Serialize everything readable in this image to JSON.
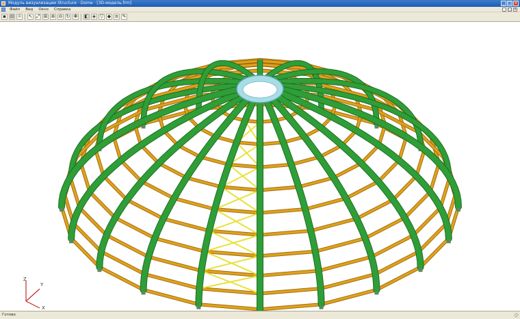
{
  "window": {
    "title": "Модуль визуализации Structure · Dome · [3D-модель.frm]",
    "minimize_glyph": "_",
    "maximize_glyph": "□",
    "close_glyph": "×"
  },
  "menu": {
    "items": [
      "Файл",
      "Вид",
      "Окно",
      "Справка"
    ]
  },
  "toolbar": {
    "buttons": [
      {
        "icon": "save-icon",
        "glyph": "▪"
      },
      {
        "icon": "print-icon",
        "glyph": "▤"
      },
      {
        "icon": "light-icon",
        "glyph": "☼"
      },
      {
        "icon": "select-icon",
        "glyph": "↖"
      },
      {
        "icon": "zoom-fit-icon",
        "glyph": "⤢"
      },
      {
        "icon": "zoom-window-icon",
        "glyph": "⊞"
      },
      {
        "icon": "zoom-in-icon",
        "glyph": "⊕"
      },
      {
        "icon": "zoom-out-icon",
        "glyph": "⊖"
      },
      {
        "icon": "rotate-icon",
        "glyph": "↻"
      },
      {
        "icon": "pan-icon",
        "glyph": "✥"
      },
      {
        "icon": "view-front-icon",
        "glyph": "◧"
      },
      {
        "icon": "view-3d-icon",
        "glyph": "◈"
      },
      {
        "icon": "filter-icon",
        "glyph": "▽"
      },
      {
        "icon": "color-icon",
        "glyph": "◆"
      },
      {
        "icon": "layers-icon",
        "glyph": "≡"
      },
      {
        "icon": "render-icon",
        "glyph": "✎"
      }
    ]
  },
  "viewport": {
    "axis_labels": {
      "z": "Z",
      "y": "Y",
      "x": "X"
    },
    "colors": {
      "rib": "#2f9e37",
      "rib_edge": "#1c6e25",
      "purlin": "#e0a11c",
      "purlin_edge": "#9a6a0c",
      "brace": "#e8e23a",
      "ring": "#a8dde6",
      "axis": "#c62828"
    }
  },
  "status": {
    "text": "Готово"
  }
}
